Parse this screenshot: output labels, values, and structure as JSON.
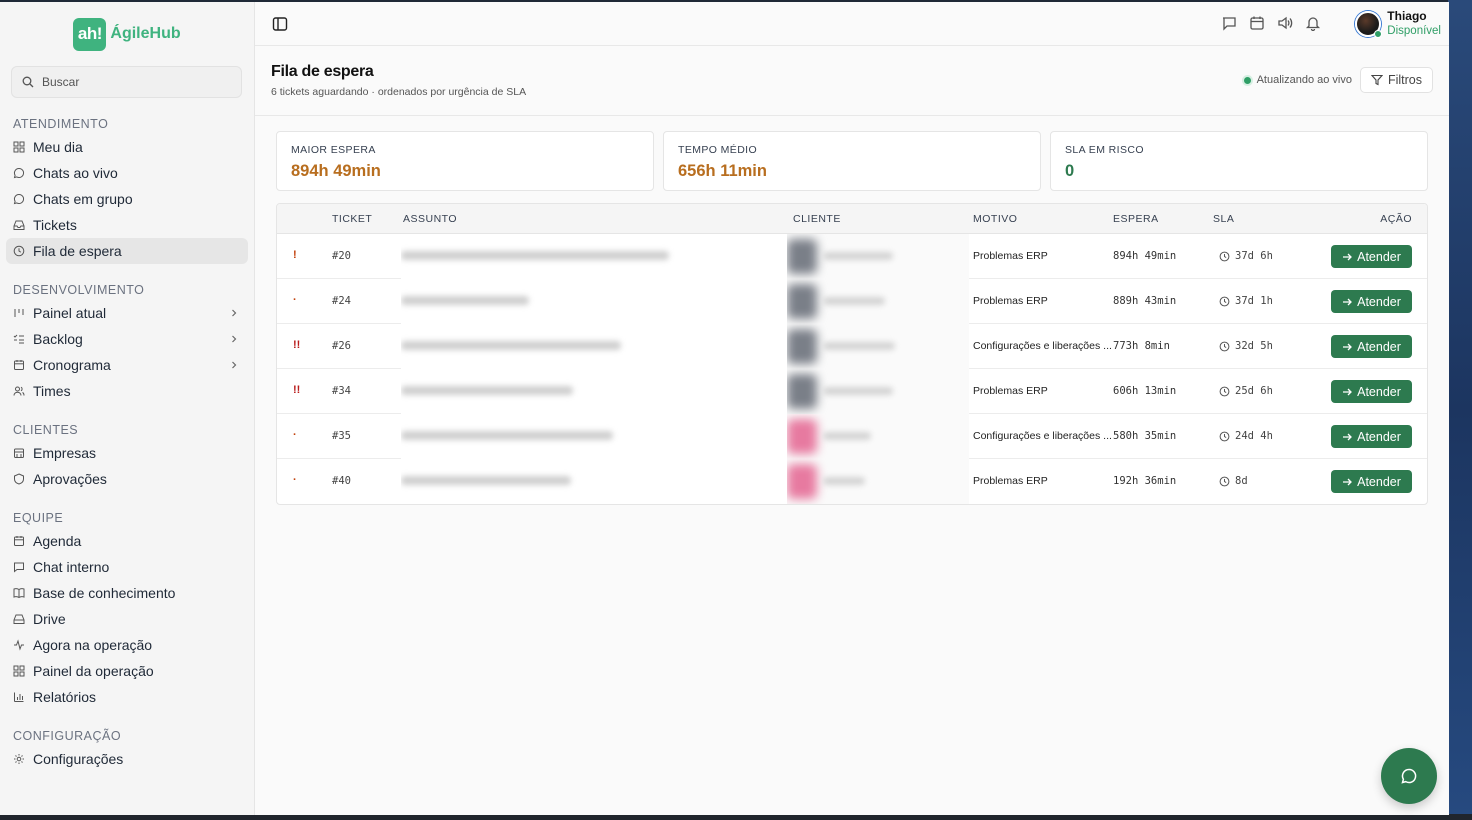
{
  "brand": {
    "badge": "ah!",
    "name": "ÁgileHub",
    "color": "#3fb37f"
  },
  "search": {
    "placeholder": "Buscar"
  },
  "sidebar": {
    "sections": [
      {
        "title": "ATENDIMENTO",
        "items": [
          {
            "label": "Meu dia",
            "icon": "grid-icon"
          },
          {
            "label": "Chats ao vivo",
            "icon": "chat-bubble-icon"
          },
          {
            "label": "Chats em grupo",
            "icon": "chat-group-icon"
          },
          {
            "label": "Tickets",
            "icon": "inbox-icon"
          },
          {
            "label": "Fila de espera",
            "icon": "clock-icon",
            "active": true
          }
        ]
      },
      {
        "title": "DESENVOLVIMENTO",
        "items": [
          {
            "label": "Painel atual",
            "icon": "kanban-icon",
            "chevron": true
          },
          {
            "label": "Backlog",
            "icon": "list-check-icon",
            "chevron": true
          },
          {
            "label": "Cronograma",
            "icon": "calendar-icon",
            "chevron": true
          },
          {
            "label": "Times",
            "icon": "users-icon"
          }
        ]
      },
      {
        "title": "CLIENTES",
        "items": [
          {
            "label": "Empresas",
            "icon": "building-icon"
          },
          {
            "label": "Aprovações",
            "icon": "shield-icon"
          }
        ]
      },
      {
        "title": "EQUIPE",
        "items": [
          {
            "label": "Agenda",
            "icon": "calendar-icon"
          },
          {
            "label": "Chat interno",
            "icon": "message-square-icon"
          },
          {
            "label": "Base de conhecimento",
            "icon": "book-icon"
          },
          {
            "label": "Drive",
            "icon": "drive-icon"
          },
          {
            "label": "Agora na operação",
            "icon": "activity-icon"
          },
          {
            "label": "Painel da operação",
            "icon": "grid-icon"
          },
          {
            "label": "Relatórios",
            "icon": "bar-chart-icon"
          }
        ]
      },
      {
        "title": "CONFIGURAÇÃO",
        "items": [
          {
            "label": "Configurações",
            "icon": "gear-icon"
          }
        ]
      }
    ]
  },
  "user": {
    "name": "Thiago",
    "status": "Disponível"
  },
  "page": {
    "title": "Fila de espera",
    "subtitle": "6 tickets aguardando · ordenados por urgência de SLA",
    "live": "Atualizando ao vivo",
    "filter_label": "Filtros"
  },
  "stats": [
    {
      "label": "MAIOR ESPERA",
      "value": "894h 49min",
      "color": "#b86e1f"
    },
    {
      "label": "TEMPO MÉDIO",
      "value": "656h 11min",
      "color": "#b86e1f"
    },
    {
      "label": "SLA EM RISCO",
      "value": "0",
      "color": "#2d7a4f"
    }
  ],
  "table": {
    "headers": {
      "ticket": "TICKET",
      "assunto": "ASSUNTO",
      "cliente": "CLIENTE",
      "motivo": "MOTIVO",
      "espera": "ESPERA",
      "sla": "SLA",
      "acao": "AÇÃO"
    },
    "rows": [
      {
        "prio": "!",
        "prio_color": "#c2410c",
        "id": "#20",
        "motivo": "Problemas ERP",
        "espera": "894h 49min",
        "sla": "37d 6h",
        "client_color": "#7a7f88"
      },
      {
        "prio": "·",
        "prio_color": "#c2410c",
        "id": "#24",
        "motivo": "Problemas ERP",
        "espera": "889h 43min",
        "sla": "37d 1h",
        "client_color": "#7a7f88"
      },
      {
        "prio": "!!",
        "prio_color": "#b91c1c",
        "id": "#26",
        "motivo": "Configurações e liberações ...",
        "espera": "773h 8min",
        "sla": "32d 5h",
        "client_color": "#7a7f88"
      },
      {
        "prio": "!!",
        "prio_color": "#b91c1c",
        "id": "#34",
        "motivo": "Problemas ERP",
        "espera": "606h 13min",
        "sla": "25d 6h",
        "client_color": "#7a7f88"
      },
      {
        "prio": "·",
        "prio_color": "#c2410c",
        "id": "#35",
        "motivo": "Configurações e liberações ...",
        "espera": "580h 35min",
        "sla": "24d 4h",
        "client_color": "#e77aa0"
      },
      {
        "prio": "·",
        "prio_color": "#c2410c",
        "id": "#40",
        "motivo": "Problemas ERP",
        "espera": "192h 36min",
        "sla": "8d",
        "client_color": "#e77aa0"
      }
    ],
    "action_label": "Atender"
  }
}
